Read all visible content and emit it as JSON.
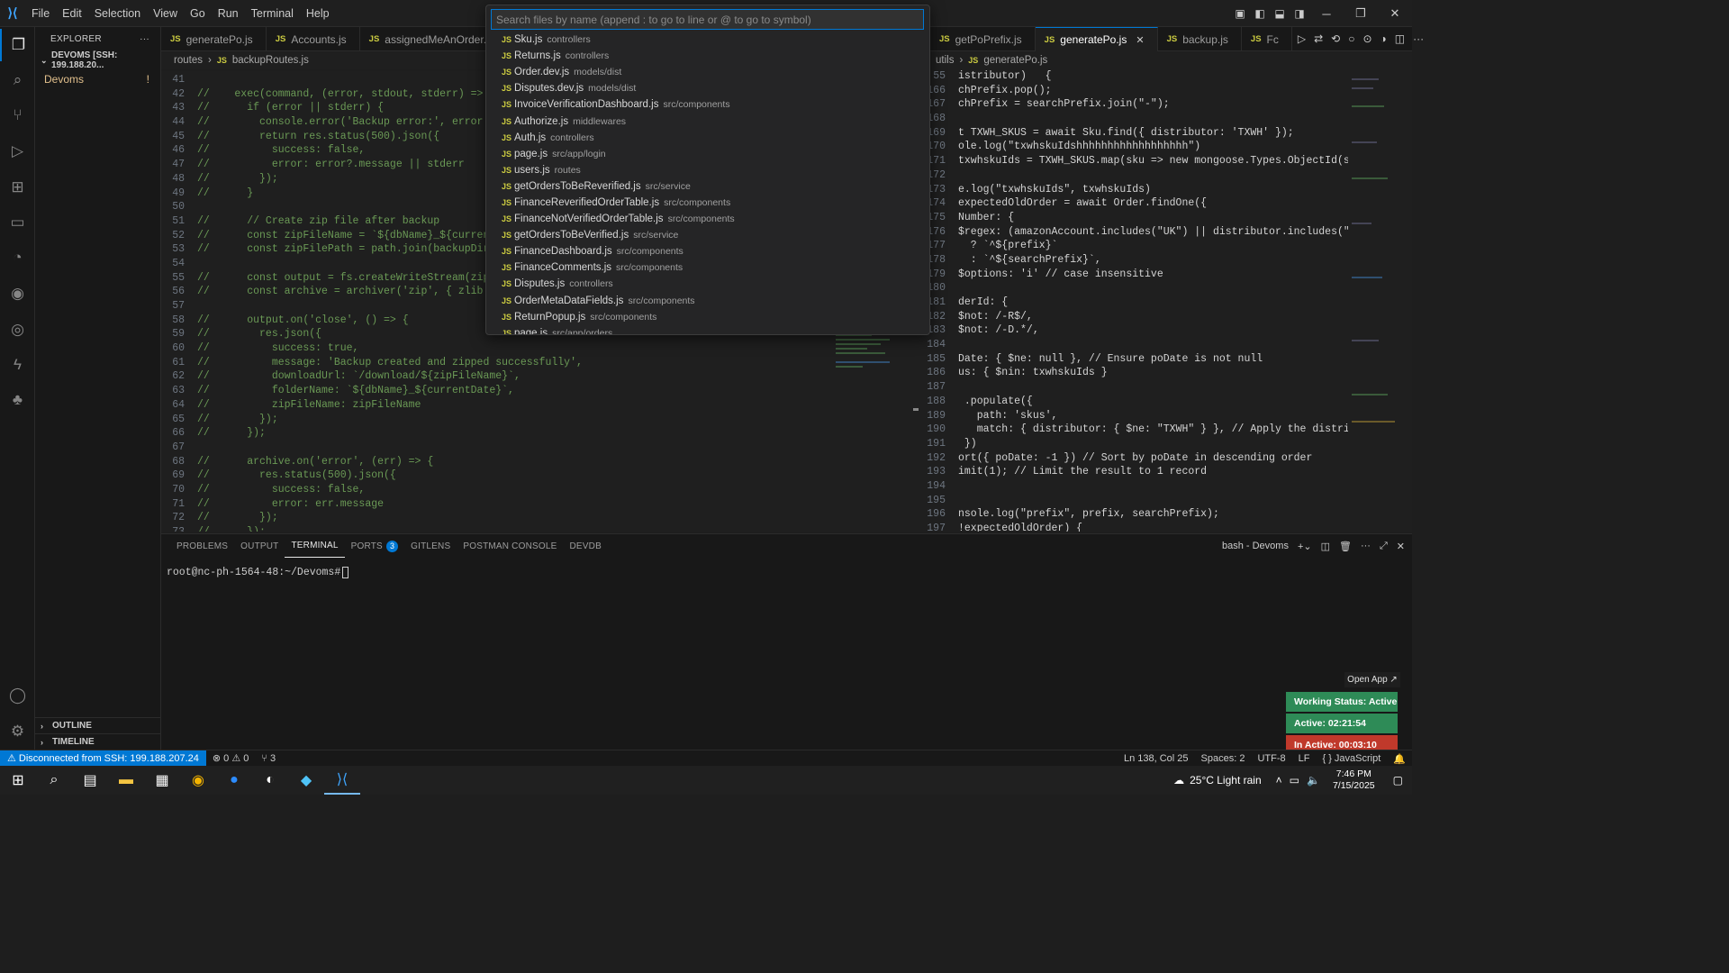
{
  "menu": [
    "File",
    "Edit",
    "Selection",
    "View",
    "Go",
    "Run",
    "Terminal",
    "Help"
  ],
  "sidebar": {
    "title": "EXPLORER",
    "more": "···",
    "root": "DEVOMS [SSH: 199.188.20...",
    "item": "Devoms",
    "item_badge": "!",
    "outline": "OUTLINE",
    "timeline": "TIMELINE"
  },
  "left_editor": {
    "tabs": [
      "generatePo.js",
      "Accounts.js",
      "assignedMeAnOrder.js"
    ],
    "breadcrumb": [
      "routes",
      "backupRoutes.js"
    ],
    "lines": [
      {
        "n": "41",
        "t": ""
      },
      {
        "n": "42",
        "t": "//    exec(command, (error, stdout, stderr) => {"
      },
      {
        "n": "43",
        "t": "//      if (error || stderr) {"
      },
      {
        "n": "44",
        "t": "//        console.error('Backup error:', error ||"
      },
      {
        "n": "45",
        "t": "//        return res.status(500).json({"
      },
      {
        "n": "46",
        "t": "//          success: false,"
      },
      {
        "n": "47",
        "t": "//          error: error?.message || stderr"
      },
      {
        "n": "48",
        "t": "//        });"
      },
      {
        "n": "49",
        "t": "//      }"
      },
      {
        "n": "50",
        "t": ""
      },
      {
        "n": "51",
        "t": "//      // Create zip file after backup"
      },
      {
        "n": "52",
        "t": "//      const zipFileName = `${dbName}_${currentD"
      },
      {
        "n": "53",
        "t": "//      const zipFilePath = path.join(backupDir,"
      },
      {
        "n": "54",
        "t": ""
      },
      {
        "n": "55",
        "t": "//      const output = fs.createWriteStream(zipFi"
      },
      {
        "n": "56",
        "t": "//      const archive = archiver('zip', { zlib: {"
      },
      {
        "n": "57",
        "t": ""
      },
      {
        "n": "58",
        "t": "//      output.on('close', () => {"
      },
      {
        "n": "59",
        "t": "//        res.json({"
      },
      {
        "n": "60",
        "t": "//          success: true,"
      },
      {
        "n": "61",
        "t": "//          message: 'Backup created and zipped successfully',"
      },
      {
        "n": "62",
        "t": "//          downloadUrl: `/download/${zipFileName}`,"
      },
      {
        "n": "63",
        "t": "//          folderName: `${dbName}_${currentDate}`,"
      },
      {
        "n": "64",
        "t": "//          zipFileName: zipFileName"
      },
      {
        "n": "65",
        "t": "//        });"
      },
      {
        "n": "66",
        "t": "//      });"
      },
      {
        "n": "67",
        "t": ""
      },
      {
        "n": "68",
        "t": "//      archive.on('error', (err) => {"
      },
      {
        "n": "69",
        "t": "//        res.status(500).json({"
      },
      {
        "n": "70",
        "t": "//          success: false,"
      },
      {
        "n": "71",
        "t": "//          error: err.message"
      },
      {
        "n": "72",
        "t": "//        });"
      },
      {
        "n": "73",
        "t": "//      });"
      }
    ]
  },
  "right_editor": {
    "tabs": [
      "getPoPrefix.js",
      "generatePo.js",
      "backup.js"
    ],
    "tab_overflow": "Fc",
    "breadcrumb": [
      "utils",
      "generatePo.js"
    ],
    "lines": [
      {
        "n": "55",
        "t": "istributor)   {"
      },
      {
        "n": "166",
        "t": "chPrefix.pop();"
      },
      {
        "n": "167",
        "t": "chPrefix = searchPrefix.join(\"-\");"
      },
      {
        "n": "168",
        "t": ""
      },
      {
        "n": "169",
        "t": "t TXWH_SKUS = await Sku.find({ distributor: 'TXWH' });"
      },
      {
        "n": "170",
        "t": "ole.log(\"txwhskuIdshhhhhhhhhhhhhhhhhh\")"
      },
      {
        "n": "171",
        "t": "txwhskuIds = TXWH_SKUS.map(sku => new mongoose.Types.ObjectId(sku."
      },
      {
        "n": "172",
        "t": ""
      },
      {
        "n": "173",
        "t": "e.log(\"txwhskuIds\", txwhskuIds)"
      },
      {
        "n": "174",
        "t": "expectedOldOrder = await Order.findOne({"
      },
      {
        "n": "175",
        "t": "Number: {"
      },
      {
        "n": "176",
        "t": "$regex: (amazonAccount.includes(\"UK\") || distributor.includes(\"Exc"
      },
      {
        "n": "177",
        "t": "  ? `^${prefix}`"
      },
      {
        "n": "178",
        "t": "  : `^${searchPrefix}`,"
      },
      {
        "n": "179",
        "t": "$options: 'i' // case insensitive"
      },
      {
        "n": "180",
        "t": ""
      },
      {
        "n": "181",
        "t": "derId: {"
      },
      {
        "n": "182",
        "t": "$not: /-R$/,"
      },
      {
        "n": "183",
        "t": "$not: /-D.*/,"
      },
      {
        "n": "184",
        "t": ""
      },
      {
        "n": "185",
        "t": "Date: { $ne: null }, // Ensure poDate is not null"
      },
      {
        "n": "186",
        "t": "us: { $nin: txwhskuIds }"
      },
      {
        "n": "187",
        "t": ""
      },
      {
        "n": "188",
        "t": " .populate({"
      },
      {
        "n": "189",
        "t": "   path: 'skus',"
      },
      {
        "n": "190",
        "t": "   match: { distributor: { $ne: \"TXWH\" } }, // Apply the distribut"
      },
      {
        "n": "191",
        "t": " })"
      },
      {
        "n": "192",
        "t": "ort({ poDate: -1 }) // Sort by poDate in descending order"
      },
      {
        "n": "193",
        "t": "imit(1); // Limit the result to 1 record"
      },
      {
        "n": "194",
        "t": ""
      },
      {
        "n": "195",
        "t": ""
      },
      {
        "n": "196",
        "t": "nsole.log(\"prefix\", prefix, searchPrefix);"
      },
      {
        "n": "197",
        "t": "!expectedOldOrder) {"
      }
    ]
  },
  "quick_open": {
    "placeholder": "Search files by name (append : to go to line or @ to go to symbol)",
    "items": [
      {
        "name": "Sku.js",
        "path": "controllers"
      },
      {
        "name": "Returns.js",
        "path": "controllers"
      },
      {
        "name": "Order.dev.js",
        "path": "models/dist"
      },
      {
        "name": "Disputes.dev.js",
        "path": "models/dist"
      },
      {
        "name": "InvoiceVerificationDashboard.js",
        "path": "src/components"
      },
      {
        "name": "Authorize.js",
        "path": "middlewares"
      },
      {
        "name": "Auth.js",
        "path": "controllers"
      },
      {
        "name": "page.js",
        "path": "src/app/login"
      },
      {
        "name": "users.js",
        "path": "routes"
      },
      {
        "name": "getOrdersToBeReverified.js",
        "path": "src/service"
      },
      {
        "name": "FinanceReverifiedOrderTable.js",
        "path": "src/components"
      },
      {
        "name": "FinanceNotVerifiedOrderTable.js",
        "path": "src/components"
      },
      {
        "name": "getOrdersToBeVerified.js",
        "path": "src/service"
      },
      {
        "name": "FinanceDashboard.js",
        "path": "src/components"
      },
      {
        "name": "FinanceComments.js",
        "path": "src/components"
      },
      {
        "name": "Disputes.js",
        "path": "controllers"
      },
      {
        "name": "OrderMetaDataFields.js",
        "path": "src/components"
      },
      {
        "name": "ReturnPopup.js",
        "path": "src/components"
      },
      {
        "name": "page.js",
        "path": "src/app/orders"
      }
    ]
  },
  "panel": {
    "tabs": [
      "PROBLEMS",
      "OUTPUT",
      "TERMINAL",
      "PORTS",
      "GITLENS",
      "POSTMAN CONSOLE",
      "DEVDB"
    ],
    "ports_badge": "3",
    "active_tab": "TERMINAL",
    "shell": "bash - Devoms",
    "prompt": "root@nc-ph-1564-48:~/Devoms# "
  },
  "widget": {
    "open_app": "Open App ↗",
    "working_status": "Working Status: Active",
    "active_time": "Active: 02:21:54",
    "inactive_time": "In Active: 00:03:10",
    "colors": {
      "status": "#2e8b57",
      "active": "#2e8b57",
      "inactive": "#c0392b"
    }
  },
  "statusbar": {
    "remote": "⚠ Disconnected from SSH: 199.188.207.24",
    "errors": "⊗ 0 ⚠ 0",
    "ports": "⑂ 3",
    "position": "Ln 138, Col 25",
    "spaces": "Spaces: 2",
    "encoding": "UTF-8",
    "eol": "LF",
    "language": "{ } JavaScript"
  },
  "taskbar": {
    "weather": "25°C  Light rain",
    "time": "7:46 PM",
    "date": "7/15/2025"
  },
  "colors": {
    "accent": "#0078d4",
    "comment": "#6a9955"
  }
}
